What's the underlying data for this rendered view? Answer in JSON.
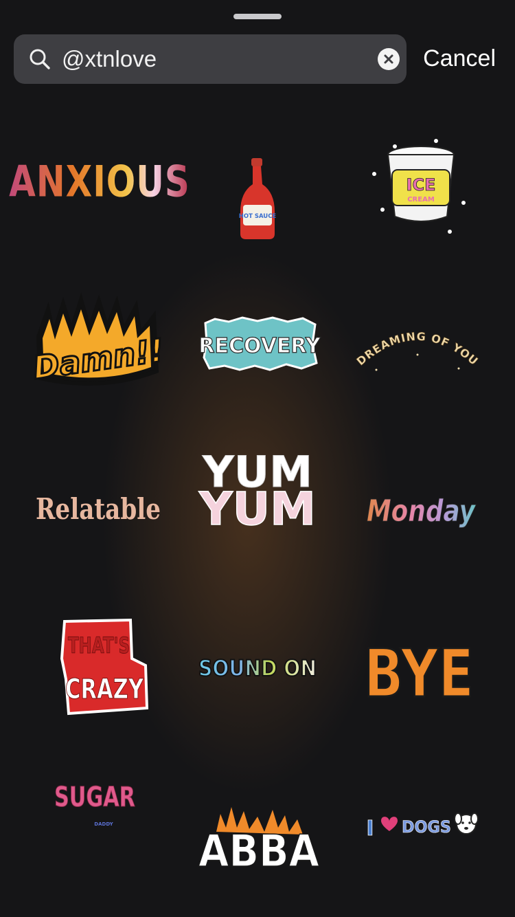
{
  "search": {
    "query": "@xtnlove",
    "cancel_label": "Cancel"
  },
  "icons": {
    "search": "magnifier-icon",
    "clear": "clear-circle-x-icon"
  },
  "stickers": [
    {
      "text": "ANXIOUS"
    },
    {
      "text": "HOT SAUCE"
    },
    {
      "text": "ICE",
      "text2": "CREAM"
    },
    {
      "text": "Damn!!"
    },
    {
      "text": "RECOVERY"
    },
    {
      "text": "DREAMING OF YOU"
    },
    {
      "text": "Relatable"
    },
    {
      "text": "YUM"
    },
    {
      "text": "Monday"
    },
    {
      "text": "THAT'S",
      "text2": "CRAZY"
    },
    {
      "text": "SOUND ON"
    },
    {
      "text": "BYE"
    },
    {
      "text": "SUGAR",
      "text2": "DADDY"
    },
    {
      "text": "ABBA"
    },
    {
      "text": "I",
      "text2": "DOGS"
    }
  ]
}
